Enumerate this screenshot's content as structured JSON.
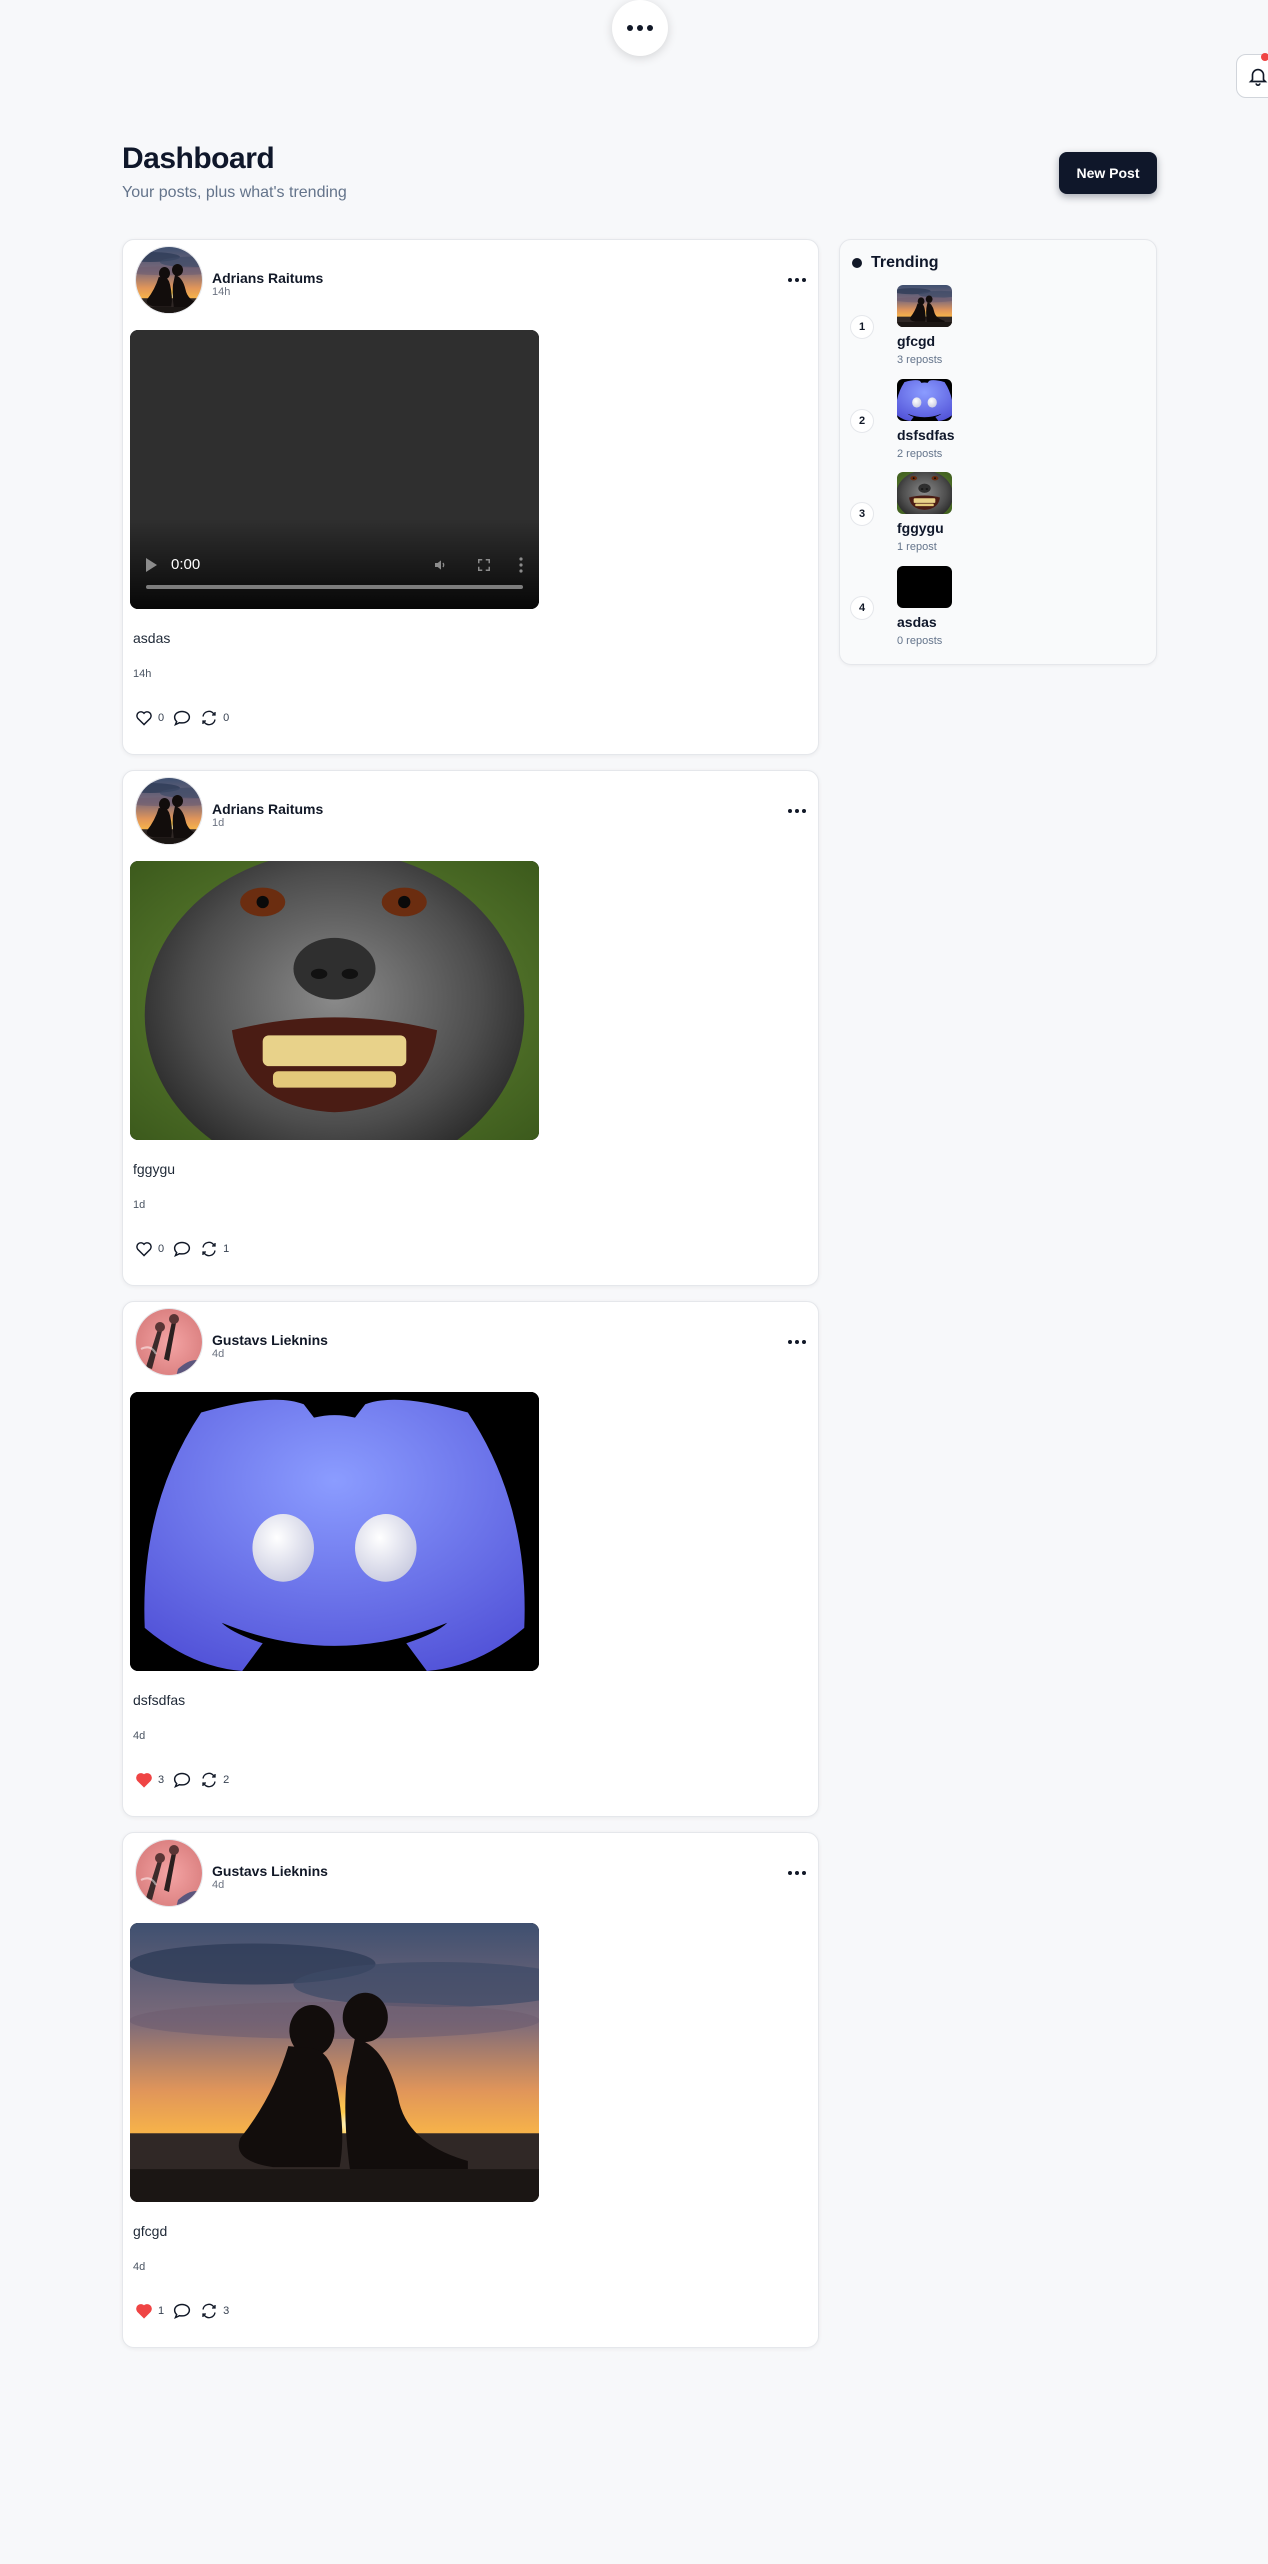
{
  "top_menu": {
    "icon": "more-horizontal-icon"
  },
  "notifications": {
    "icon": "bell-icon",
    "badge_color": "#ef4444"
  },
  "header": {
    "title": "Dashboard",
    "subtitle": "Your posts, plus what's trending",
    "new_post_label": "New Post"
  },
  "posts": [
    {
      "author": "Adrians Raitums",
      "time": "14h",
      "media": "video",
      "video_time": "0:00",
      "caption": "asdas",
      "likes": "0",
      "liked": false,
      "reposts": "0"
    },
    {
      "author": "Adrians Raitums",
      "time": "1d",
      "media": "image-monkey",
      "caption": "fggygu",
      "likes": "0",
      "liked": false,
      "reposts": "1"
    },
    {
      "author": "Gustavs Lieknins",
      "time": "4d",
      "media": "image-discord",
      "caption": "dsfsdfas",
      "likes": "3",
      "liked": true,
      "reposts": "2"
    },
    {
      "author": "Gustavs Lieknins",
      "time": "4d",
      "media": "image-sunset",
      "caption": "gfcgd",
      "likes": "1",
      "liked": true,
      "reposts": "3"
    }
  ],
  "trending": {
    "title": "Trending",
    "items": [
      {
        "rank": "1",
        "name": "gfcgd",
        "reposts": "3 reposts"
      },
      {
        "rank": "2",
        "name": "dsfsdfas",
        "reposts": "2 reposts"
      },
      {
        "rank": "3",
        "name": "fggygu",
        "reposts": "1 repost"
      },
      {
        "rank": "4",
        "name": "asdas",
        "reposts": "0 reposts"
      }
    ]
  },
  "colors": {
    "accent": "#0f172a",
    "like": "#ef4444",
    "background": "#f7f8fa"
  }
}
